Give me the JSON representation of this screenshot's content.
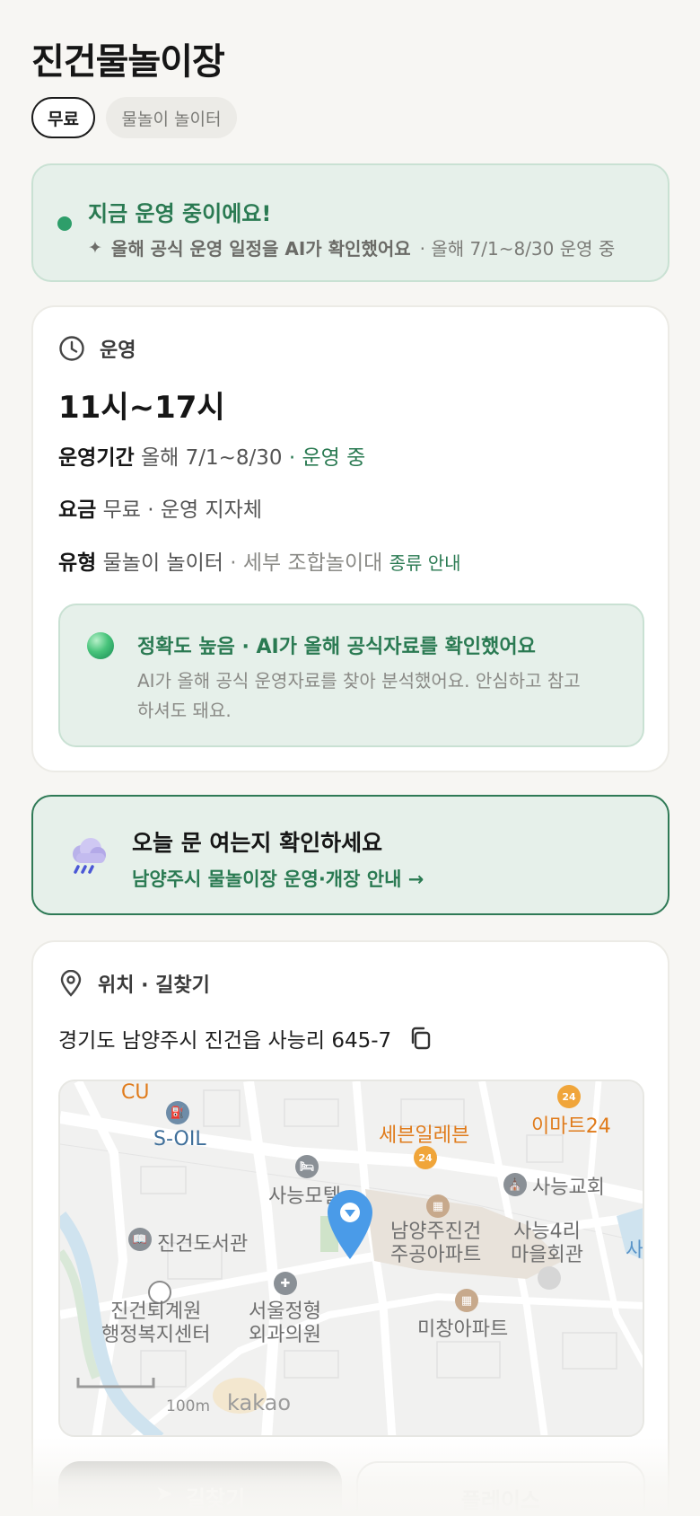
{
  "header": {
    "title": "진건물놀이장"
  },
  "chips": {
    "price": "무료",
    "type": "물놀이 놀이터"
  },
  "status": {
    "title": "지금 운영 중이에요!",
    "ai_note": "올해 공식 운영 일정을 AI가 확인했어요",
    "schedule": "· 올해 7/1~8/30 운영 중"
  },
  "operation": {
    "section_title": "운영",
    "hours": "11시~17시",
    "period_label": "운영기간",
    "period_value": "올해 7/1~8/30",
    "period_status": "· 운영 중",
    "fee_label": "요금",
    "fee_value": "무료 · 운영 지자체",
    "type_label": "유형",
    "type_value": "물놀이 놀이터",
    "type_detail": "· 세부 조합놀이대",
    "type_link": "종류 안내",
    "accuracy_title": "정확도 높음 · AI가 올해 공식자료를 확인했어요",
    "accuracy_text": "AI가 올해 공식 운영자료를 찾아 분석했어요. 안심하고 참고하셔도 돼요."
  },
  "notice": {
    "icon": "rain-cloud-icon",
    "title": "오늘 문 여는지 확인하세요",
    "link": "남양주시 물놀이장 운영·개장 안내 →"
  },
  "location": {
    "section_title": "위치 · 길찾기",
    "address": "경기도 남양주시 진건읍 사능리 645-7",
    "map": {
      "labels": {
        "cu": "CU",
        "soil": "S-OIL",
        "seven": "세븐일레븐",
        "emart": "이마트24",
        "church": "사능교회",
        "motel": "사능모텔",
        "library": "진건도서관",
        "apt1": "남양주진건\n주공아파트",
        "hall": "사능4리\n마을회관",
        "center": "진건퇴계원\n행정복지센터",
        "clinic": "서울정형\n외과의원",
        "apt2": "미창아파트",
        "edge": "사"
      },
      "scale": "100m",
      "provider": "kakao"
    },
    "directions_button": "길찾기",
    "place_button": "플레이스"
  },
  "colors": {
    "accent_green": "#2a7a52",
    "status_bg": "#e6f0ea",
    "pin_blue": "#4a9be8",
    "poi_orange": "#e07b1b"
  }
}
